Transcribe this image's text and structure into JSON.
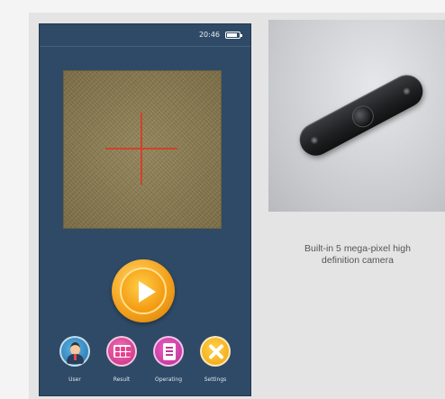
{
  "status_bar": {
    "time": "20:46",
    "battery": "battery-icon"
  },
  "viewfinder": {
    "crosshair_color": "#d0432a"
  },
  "play_button": {
    "icon": "play-icon",
    "color": "#f4a21d"
  },
  "nav": [
    {
      "label": "User",
      "icon": "user-icon"
    },
    {
      "label": "Result",
      "icon": "result-icon"
    },
    {
      "label": "Operating",
      "icon": "operating-icon"
    },
    {
      "label": "Settings",
      "icon": "settings-icon"
    }
  ],
  "caption": {
    "line1": "Built-in 5 mega-pixel high",
    "line2": "definition camera"
  },
  "colors": {
    "device_bg": "#2f4a66",
    "accent": "#f4a21d"
  }
}
